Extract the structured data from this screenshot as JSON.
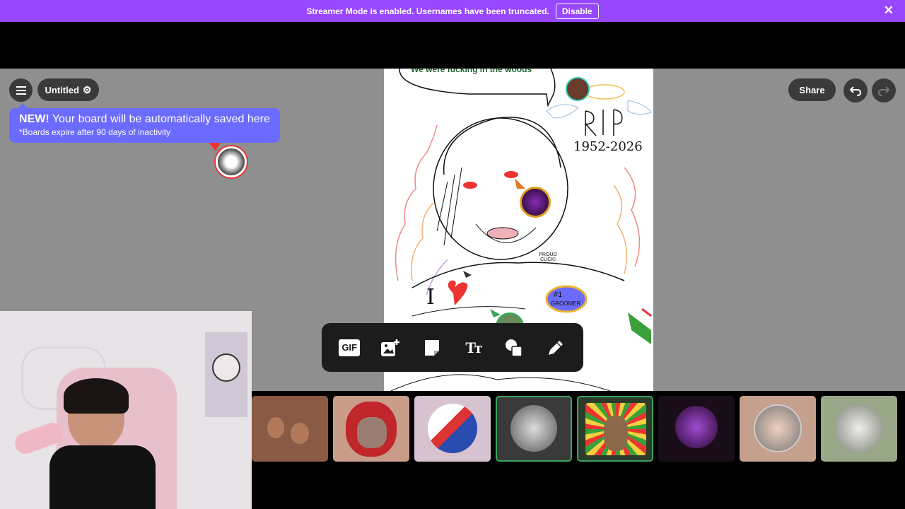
{
  "banner": {
    "message": "Streamer Mode is enabled. Usernames have been truncated.",
    "disable_label": "Disable",
    "close_icon": "close-icon",
    "color": "#9747ff"
  },
  "header": {
    "menu_icon": "hamburger-icon",
    "board_title": "Untitled",
    "settings_icon": "gear-icon",
    "share_label": "Share",
    "undo_icon": "undo-icon",
    "redo_icon": "redo-icon"
  },
  "tooltip": {
    "new_label": "NEW!",
    "message": " Your board will be automatically saved here",
    "subtext": "*Boards expire after 90 days of inactivity",
    "color": "#6b6bff"
  },
  "board": {
    "speech_text": "We were fucking in the woods",
    "dates": "1952-2026",
    "proud_text": "PROUD CUCK!",
    "badge_number": "#1",
    "badge_text": "GROOMER",
    "letter": "I"
  },
  "toolbar": {
    "tools": [
      {
        "name": "gif-tool",
        "label": "GIF"
      },
      {
        "name": "image-add-icon",
        "label": ""
      },
      {
        "name": "sticky-note-icon",
        "label": ""
      },
      {
        "name": "text-tool",
        "label": "Tт"
      },
      {
        "name": "shapes-icon",
        "label": ""
      },
      {
        "name": "pencil-icon",
        "label": ""
      }
    ]
  },
  "stickers": [
    {
      "name": "sticker-bears",
      "bg": "#8a5a44",
      "selected": false
    },
    {
      "name": "sticker-hood",
      "bg": "#c99d8a",
      "selected": false
    },
    {
      "name": "sticker-flag-person",
      "bg": "#d6c3cf",
      "selected": false
    },
    {
      "name": "sticker-hand",
      "bg": "#3a3a3a",
      "selected": true
    },
    {
      "name": "sticker-anime",
      "bg": "#2d3b2a",
      "selected": true
    },
    {
      "name": "sticker-cat",
      "bg": "#1a0d1a",
      "selected": false
    },
    {
      "name": "sticker-man",
      "bg": "#c4a08d",
      "selected": false
    },
    {
      "name": "sticker-plane",
      "bg": "#9aa88a",
      "selected": false
    }
  ]
}
